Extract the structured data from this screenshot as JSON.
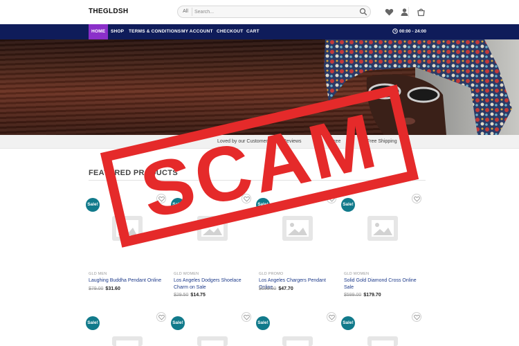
{
  "header": {
    "logo": "THEGLDSH",
    "search": {
      "category": "All",
      "placeholder": "Search..."
    },
    "icons": [
      "heart-icon",
      "user-icon",
      "cart-icon"
    ]
  },
  "nav": {
    "items": [
      {
        "label": "HOME",
        "active": true
      },
      {
        "label": "SHOP",
        "active": false
      },
      {
        "label": "TERMS & CONDITIONS",
        "active": false
      },
      {
        "label": "MY ACCOUNT",
        "active": false
      },
      {
        "label": "CHECKOUT",
        "active": false
      },
      {
        "label": "CART",
        "active": false
      }
    ],
    "hours": "00:00 - 24:00"
  },
  "trust_bar": {
    "items": [
      "Loved by our Customers",
      "Reviews",
      "Free",
      "Free Shipping"
    ]
  },
  "featured": {
    "title": "FEATURED PRODUCTS",
    "products": [
      {
        "sale": "Sale!",
        "category": "GLD MEN",
        "name": "Laughing Buddha Pendant Online",
        "old_price": "$79.00",
        "price": "$31.60"
      },
      {
        "sale": "Sale!",
        "category": "GLD WOMEN",
        "name": "Los Angeles Dodgers Shoelace Charm on Sale",
        "old_price": "$29.50",
        "price": "$14.75"
      },
      {
        "sale": "Sale!",
        "category": "GLD PROMO",
        "name": "Los Angeles Chargers Pendant Online",
        "old_price": "$159.00",
        "price": "$47.70"
      },
      {
        "sale": "Sale!",
        "category": "GLD WOMEN",
        "name": "Solid Gold Diamond Cross Online Sale",
        "old_price": "$599.00",
        "price": "$179.70"
      }
    ],
    "row2": [
      {
        "sale": "Sale!"
      },
      {
        "sale": "Sale!"
      },
      {
        "sale": "Sale!"
      },
      {
        "sale": "Sale!"
      }
    ]
  },
  "stamp": {
    "text": "SCAM",
    "color": "#e52a2a"
  },
  "colors": {
    "nav": "#0f1c5a",
    "active": "#8b2fc9",
    "badge": "#117a8b",
    "link": "#1d3a8a"
  }
}
